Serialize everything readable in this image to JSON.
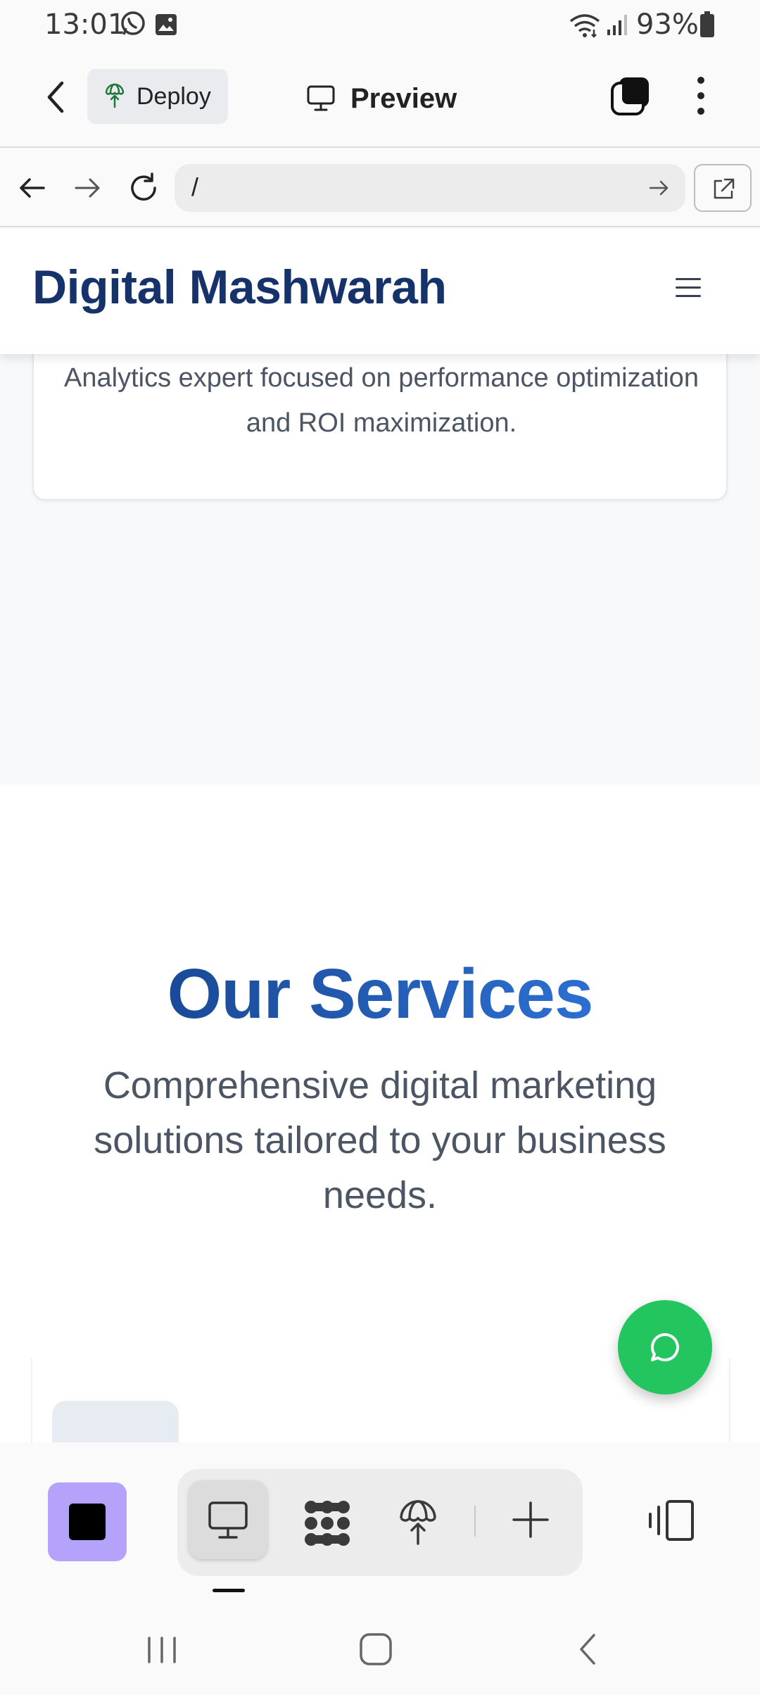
{
  "status_bar": {
    "time": "13:01",
    "battery": "93%",
    "icons": [
      "whatsapp-icon",
      "gallery-icon",
      "wifi-icon",
      "signal-icon",
      "battery-icon"
    ]
  },
  "app_bar": {
    "deploy_label": "Deploy",
    "title": "Preview"
  },
  "url_bar": {
    "value": "/"
  },
  "site": {
    "logo": "Digital Mashwarah",
    "card_text": "Analytics expert focused on performance optimization and ROI maximization.",
    "services_title": "Our Services",
    "services_subtitle": "Comprehensive digital marketing solutions tailored to your business needs."
  },
  "toolbar": {
    "tools": [
      "preview-tool",
      "agents-tool",
      "deploy-tool",
      "add-tool"
    ]
  },
  "colors": {
    "logo": "#15326a",
    "services_title": "#1d4f9f",
    "fab": "#22c55e",
    "stop_button": "#b4a2fb"
  }
}
